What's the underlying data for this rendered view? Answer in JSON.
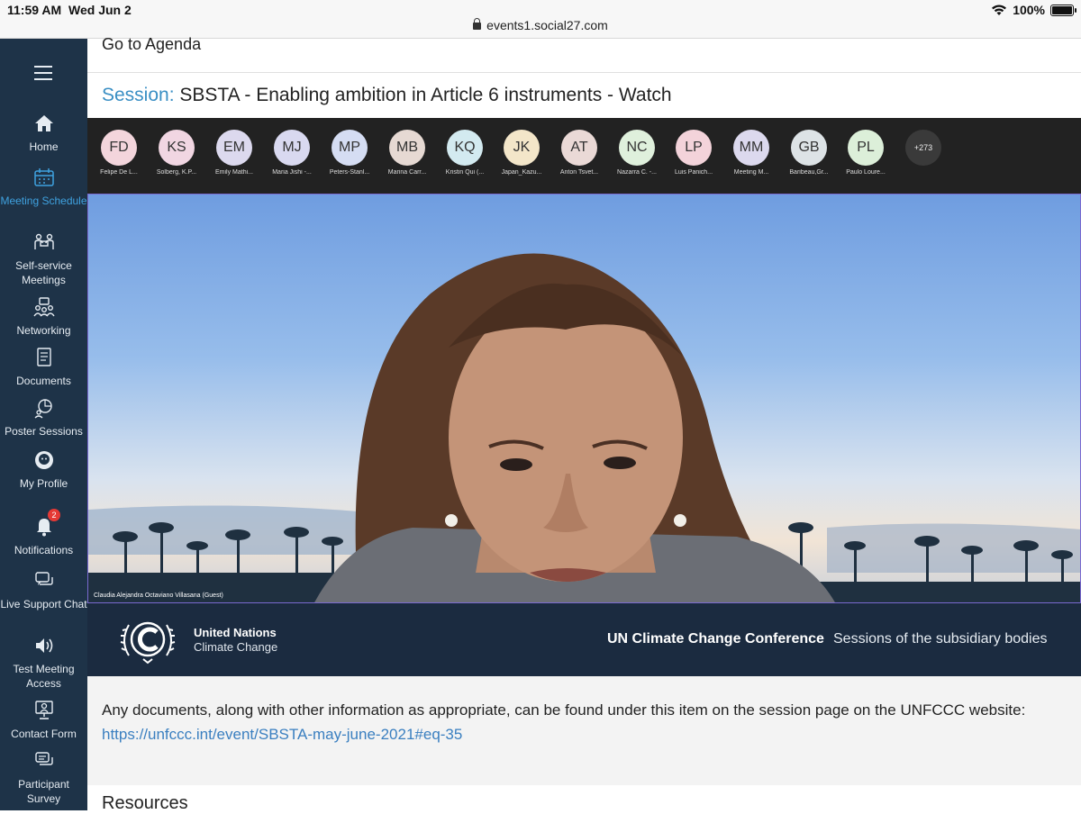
{
  "status_bar": {
    "time": "11:59 AM",
    "date": "Wed Jun 2",
    "url": "events1.social27.com",
    "battery": "100%"
  },
  "sidebar": {
    "menu_icon": "hamburger-icon",
    "items": [
      {
        "label": "Home",
        "icon": "home-icon",
        "active": false
      },
      {
        "label": "Meeting Schedule",
        "icon": "calendar-icon",
        "active": true
      },
      {
        "label": "Self-service Meetings",
        "icon": "meeting-people-icon",
        "active": false
      },
      {
        "label": "Networking",
        "icon": "networking-icon",
        "active": false
      },
      {
        "label": "Documents",
        "icon": "documents-icon",
        "active": false
      },
      {
        "label": "Poster Sessions",
        "icon": "poster-icon",
        "active": false
      },
      {
        "label": "My Profile",
        "icon": "profile-icon",
        "active": false
      },
      {
        "label": "Notifications",
        "icon": "bell-icon",
        "active": false,
        "badge": "2"
      },
      {
        "label": "Live Support Chat",
        "icon": "chat-icon",
        "active": false
      },
      {
        "label": "Test Meeting Access",
        "icon": "speaker-icon",
        "active": false
      },
      {
        "label": "Contact Form",
        "icon": "contact-icon",
        "active": false
      },
      {
        "label": "Participant Survey",
        "icon": "survey-icon",
        "active": false
      }
    ]
  },
  "main": {
    "agenda_link": "Go to Agenda",
    "session_prefix": "Session:",
    "session_title": "SBSTA - Enabling ambition in Article 6 instruments - Watch",
    "participants": [
      {
        "initials": "FD",
        "name": "Felipe De L...",
        "color": "#f3d5dc"
      },
      {
        "initials": "KS",
        "name": "Solberg, K.P...",
        "color": "#f1d6e2"
      },
      {
        "initials": "EM",
        "name": "Emily Mathi...",
        "color": "#dcd9ee"
      },
      {
        "initials": "MJ",
        "name": "Maria Jishi -...",
        "color": "#d9d9f0"
      },
      {
        "initials": "MP",
        "name": "Peters-Stanl...",
        "color": "#d5ddf3"
      },
      {
        "initials": "MB",
        "name": "Marina Carr...",
        "color": "#e6d9d3"
      },
      {
        "initials": "KQ",
        "name": "Kristin Qui (...",
        "color": "#d3eaf0"
      },
      {
        "initials": "JK",
        "name": "Japan_Kazu...",
        "color": "#f3e6c9"
      },
      {
        "initials": "AT",
        "name": "Anton Tsvet...",
        "color": "#ead9d6"
      },
      {
        "initials": "NC",
        "name": "Nazarra C. -...",
        "color": "#dff0dc"
      },
      {
        "initials": "LP",
        "name": "Luis Panich...",
        "color": "#f3d3da"
      },
      {
        "initials": "MM",
        "name": "Meeting M...",
        "color": "#dcd9ee"
      },
      {
        "initials": "GB",
        "name": "Baribeau,Gr...",
        "color": "#dde3e6"
      },
      {
        "initials": "PL",
        "name": "Paulo Loure...",
        "color": "#dcefd9"
      }
    ],
    "more_participants": "+273",
    "speaker_label": "Claudia Alejandra Octaviano Villasana (Guest)",
    "banner": {
      "org_name": "United Nations",
      "org_sub": "Climate Change",
      "conference_title": "UN Climate Change Conference",
      "conference_sub": "Sessions of the subsidiary bodies"
    },
    "info_text": "Any documents, along with other information as appropriate, can be found under this item on the session page on the UNFCCC website:",
    "info_link": "https://unfccc.int/event/SBSTA-may-june-2021#eq-35",
    "resources_heading": "Resources"
  },
  "colors": {
    "sidebar_bg": "#1e3348",
    "active_nav": "#3fa2e0",
    "banner_bg": "#1b2b40",
    "link": "#3a7fc0",
    "notification_badge": "#e53935"
  }
}
